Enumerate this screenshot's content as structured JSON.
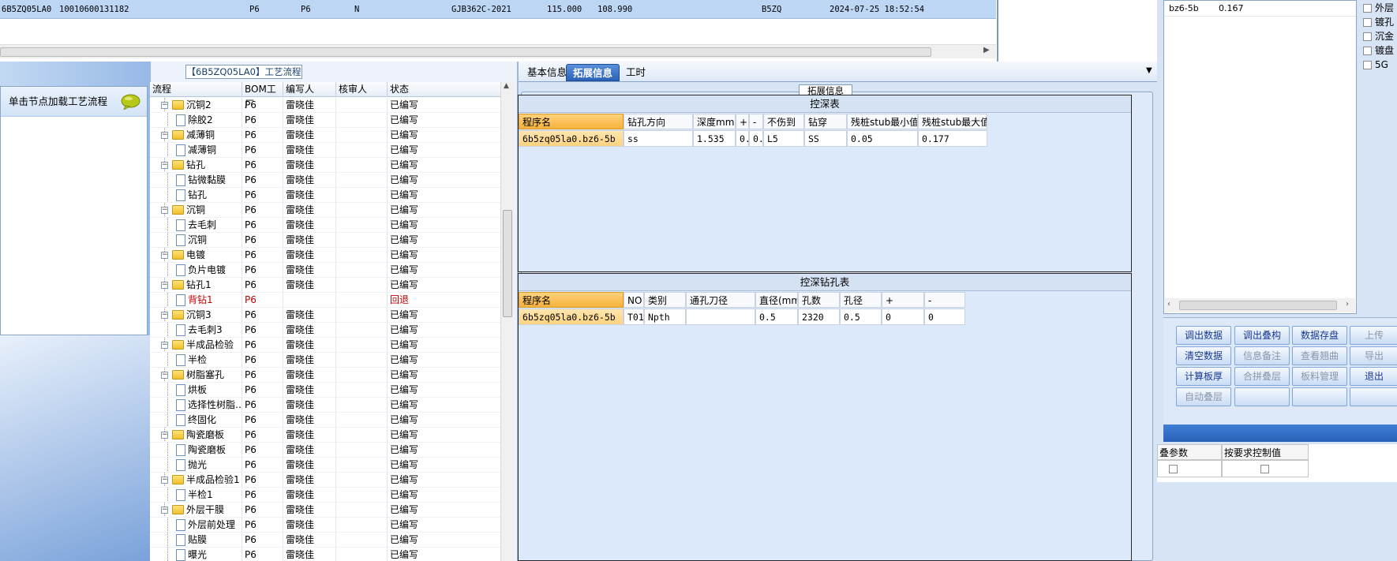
{
  "top_record": {
    "code": "6B5ZQ05LA0",
    "order_no": "10010600131182",
    "f1": "P6",
    "f2": "P6",
    "f3": "N",
    "standard": "GJB362C-2021",
    "v1": "115.000",
    "v2": "108.990",
    "short": "B5ZQ",
    "datetime": "2024-07-25 18:52:54"
  },
  "right_list": {
    "name": "bz6-5b",
    "value": "0.167"
  },
  "right_checks": [
    "外层",
    "镀孔",
    "沉金",
    "镀盘",
    "5G"
  ],
  "buttons": [
    [
      "调出数据",
      "调出叠构",
      "数据存盘",
      "上传"
    ],
    [
      "清空数据",
      "信息备注",
      "查看翘曲",
      "导出"
    ],
    [
      "计算板厚",
      "合拼叠层",
      "板料管理",
      "退出"
    ],
    [
      "自动叠层",
      "",
      "",
      ""
    ]
  ],
  "button_disabled": [
    [
      false,
      false,
      false,
      true
    ],
    [
      false,
      true,
      true,
      true
    ],
    [
      false,
      true,
      true,
      false
    ],
    [
      true,
      true,
      true,
      true
    ]
  ],
  "param_table": {
    "h1": "叠参数",
    "h2": "按要求控制值"
  },
  "left_panel": {
    "load_hint": "单击节点加载工艺流程"
  },
  "tree": {
    "title": "【6B5ZQ05LA0】工艺流程",
    "headers": [
      "流程",
      "BOM工厂",
      "编写人",
      "核审人",
      "状态"
    ],
    "rows": [
      {
        "level": 0,
        "name": "沉铜2",
        "bom": "P6",
        "writer": "雷晓佳",
        "status": "已编写",
        "red": false
      },
      {
        "level": 1,
        "name": "除胶2",
        "bom": "P6",
        "writer": "雷晓佳",
        "status": "已编写",
        "red": false
      },
      {
        "level": 0,
        "name": "减薄铜",
        "bom": "P6",
        "writer": "雷晓佳",
        "status": "已编写",
        "red": false
      },
      {
        "level": 1,
        "name": "减薄铜",
        "bom": "P6",
        "writer": "雷晓佳",
        "status": "已编写",
        "red": false
      },
      {
        "level": 0,
        "name": "钻孔",
        "bom": "P6",
        "writer": "雷晓佳",
        "status": "已编写",
        "red": false
      },
      {
        "level": 1,
        "name": "钻微黏膜",
        "bom": "P6",
        "writer": "雷晓佳",
        "status": "已编写",
        "red": false
      },
      {
        "level": 1,
        "name": "钻孔",
        "bom": "P6",
        "writer": "雷晓佳",
        "status": "已编写",
        "red": false
      },
      {
        "level": 0,
        "name": "沉铜",
        "bom": "P6",
        "writer": "雷晓佳",
        "status": "已编写",
        "red": false
      },
      {
        "level": 1,
        "name": "去毛刺",
        "bom": "P6",
        "writer": "雷晓佳",
        "status": "已编写",
        "red": false
      },
      {
        "level": 1,
        "name": "沉铜",
        "bom": "P6",
        "writer": "雷晓佳",
        "status": "已编写",
        "red": false
      },
      {
        "level": 0,
        "name": "电镀",
        "bom": "P6",
        "writer": "雷晓佳",
        "status": "已编写",
        "red": false
      },
      {
        "level": 1,
        "name": "负片电镀",
        "bom": "P6",
        "writer": "雷晓佳",
        "status": "已编写",
        "red": false
      },
      {
        "level": 0,
        "name": "钻孔1",
        "bom": "P6",
        "writer": "雷晓佳",
        "status": "已编写",
        "red": false
      },
      {
        "level": 1,
        "name": "背钻1",
        "bom": "P6",
        "writer": "",
        "status": "回退",
        "red": true
      },
      {
        "level": 0,
        "name": "沉铜3",
        "bom": "P6",
        "writer": "雷晓佳",
        "status": "已编写",
        "red": false
      },
      {
        "level": 1,
        "name": "去毛刺3",
        "bom": "P6",
        "writer": "雷晓佳",
        "status": "已编写",
        "red": false
      },
      {
        "level": 0,
        "name": "半成品检验",
        "bom": "P6",
        "writer": "雷晓佳",
        "status": "已编写",
        "red": false
      },
      {
        "level": 1,
        "name": "半检",
        "bom": "P6",
        "writer": "雷晓佳",
        "status": "已编写",
        "red": false
      },
      {
        "level": 0,
        "name": "树脂塞孔",
        "bom": "P6",
        "writer": "雷晓佳",
        "status": "已编写",
        "red": false
      },
      {
        "level": 1,
        "name": "烘板",
        "bom": "P6",
        "writer": "雷晓佳",
        "status": "已编写",
        "red": false
      },
      {
        "level": 1,
        "name": "选择性树脂…",
        "bom": "P6",
        "writer": "雷晓佳",
        "status": "已编写",
        "red": false
      },
      {
        "level": 1,
        "name": "终固化",
        "bom": "P6",
        "writer": "雷晓佳",
        "status": "已编写",
        "red": false
      },
      {
        "level": 0,
        "name": "陶瓷磨板",
        "bom": "P6",
        "writer": "雷晓佳",
        "status": "已编写",
        "red": false
      },
      {
        "level": 1,
        "name": "陶瓷磨板",
        "bom": "P6",
        "writer": "雷晓佳",
        "status": "已编写",
        "red": false
      },
      {
        "level": 1,
        "name": "抛光",
        "bom": "P6",
        "writer": "雷晓佳",
        "status": "已编写",
        "red": false
      },
      {
        "level": 0,
        "name": "半成品检验1",
        "bom": "P6",
        "writer": "雷晓佳",
        "status": "已编写",
        "red": false
      },
      {
        "level": 1,
        "name": "半检1",
        "bom": "P6",
        "writer": "雷晓佳",
        "status": "已编写",
        "red": false
      },
      {
        "level": 0,
        "name": "外层干膜",
        "bom": "P6",
        "writer": "雷晓佳",
        "status": "已编写",
        "red": false
      },
      {
        "level": 1,
        "name": "外层前处理",
        "bom": "P6",
        "writer": "雷晓佳",
        "status": "已编写",
        "red": false
      },
      {
        "level": 1,
        "name": "贴膜",
        "bom": "P6",
        "writer": "雷晓佳",
        "status": "已编写",
        "red": false
      },
      {
        "level": 1,
        "name": "曝光",
        "bom": "P6",
        "writer": "雷晓佳",
        "status": "已编写",
        "red": false
      }
    ]
  },
  "tabs": [
    "基本信息",
    "拓展信息",
    "工时"
  ],
  "active_tab": 1,
  "ext_legend": "拓展信息",
  "depth_table": {
    "title": "控深表",
    "headers": [
      "程序名",
      "钻孔方向",
      "深度mm",
      "+",
      "-",
      "不伤到",
      "钻穿",
      "残桩stub最小值",
      "残桩stub最大值"
    ],
    "row": [
      "6b5zq05la0.bz6-5b",
      "ss",
      "1.535",
      "0..",
      "0..",
      "L5",
      "SS",
      "0.05",
      "0.177"
    ]
  },
  "depth_drill_table": {
    "title": "控深钻孔表",
    "headers": [
      "程序名",
      "NO",
      "类别",
      "通孔刀径",
      "直径(mm)",
      "孔数",
      "孔径",
      "+",
      "-"
    ],
    "row": [
      "6b5zq05la0.bz6-5b",
      "T01",
      "Npth",
      "",
      "0.5",
      "2320",
      "0.5",
      "0",
      "0"
    ]
  }
}
